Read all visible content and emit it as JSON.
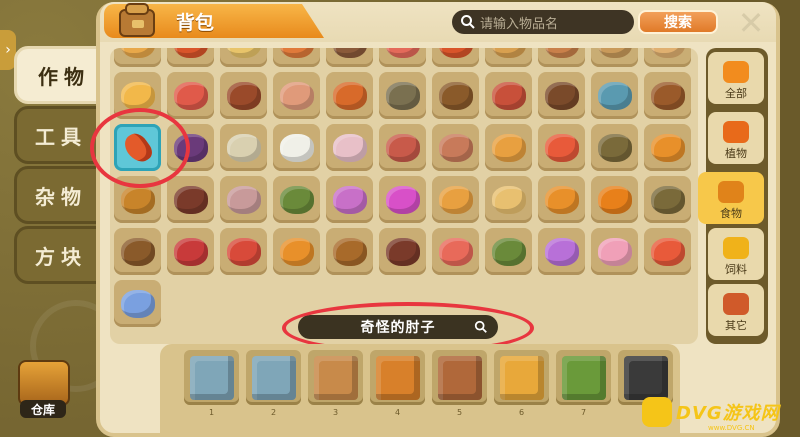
{
  "window": {
    "title": "背包",
    "close_label": "✕"
  },
  "search": {
    "placeholder": "请输入物品名",
    "button_label": "搜索"
  },
  "left_tabs": [
    {
      "label": "作物",
      "active": true
    },
    {
      "label": "工具",
      "active": false
    },
    {
      "label": "杂物",
      "active": false
    },
    {
      "label": "方块",
      "active": false
    }
  ],
  "right_tabs": [
    {
      "label": "全部",
      "icon": "carrot-icon",
      "color": "#f28c1e",
      "active": false
    },
    {
      "label": "植物",
      "icon": "plant-pot-icon",
      "color": "#e86a1a",
      "active": false
    },
    {
      "label": "食物",
      "icon": "roast-chicken-icon",
      "color": "#e0831a",
      "active": true
    },
    {
      "label": "饲料",
      "icon": "feed-pile-icon",
      "color": "#f0b21a",
      "active": false
    },
    {
      "label": "其它",
      "icon": "pizza-icon",
      "color": "#d05a2a",
      "active": false
    }
  ],
  "selected_item_name": "奇怪的肘子",
  "grid": {
    "rows": [
      [
        "#e8a84a",
        "#d9552a",
        "#e8c46a",
        "#e07a3a",
        "#8a5a3a",
        "#e46a5a",
        "#d9552a",
        "#d8a050",
        "#c9804a",
        "#c99a5a",
        "#e0b070"
      ],
      [
        "#f2b84a",
        "#e05a4a",
        "#9a4a2a",
        "#e09a7a",
        "#d86a2a",
        "#7a7050",
        "#8a5a2a",
        "#c8503a",
        "#7a4a2a",
        "#5a9ab0",
        "#9a5a2a"
      ],
      [
        "selected",
        "#6a3a7a",
        "#d9d0b0",
        "#f0f0e8",
        "#e8c0c8",
        "#c85a4a",
        "#c87a5a",
        "#e8a040",
        "#e85a3a",
        "#7a6a3a",
        "#e8902a"
      ],
      [
        "#c8842a",
        "#7a3a2a",
        "#c89a9a",
        "#6a8a3a",
        "#c870c8",
        "#d850c8",
        "#e8a040",
        "#e8c070",
        "#e8902a",
        "#e8801a",
        "#7a6a3a"
      ],
      [
        "#8a5a2a",
        "#c83a3a",
        "#d84a3a",
        "#e8902a",
        "#a86a2a",
        "#7a3a2a",
        "#e86a5a",
        "#6a8a3a",
        "#b870d8",
        "#f0a0b8",
        "#e85a3a"
      ],
      [
        "#7aa0e0"
      ]
    ]
  },
  "hotbar": [
    {
      "slot": "1",
      "color": "#7fa6b8"
    },
    {
      "slot": "2",
      "color": "#7fa6b8"
    },
    {
      "slot": "3",
      "color": "#c88a4a"
    },
    {
      "slot": "4",
      "color": "#d8802a"
    },
    {
      "slot": "5",
      "color": "#b0683a"
    },
    {
      "slot": "6",
      "color": "#e8a83a"
    },
    {
      "slot": "7",
      "color": "#6a9a3a"
    },
    {
      "slot": "8",
      "color": "#3a3a3a"
    }
  ],
  "warehouse": {
    "label": "仓库"
  },
  "watermark": {
    "text": "DVG游戏网",
    "sub": "www.DVG.CN"
  }
}
